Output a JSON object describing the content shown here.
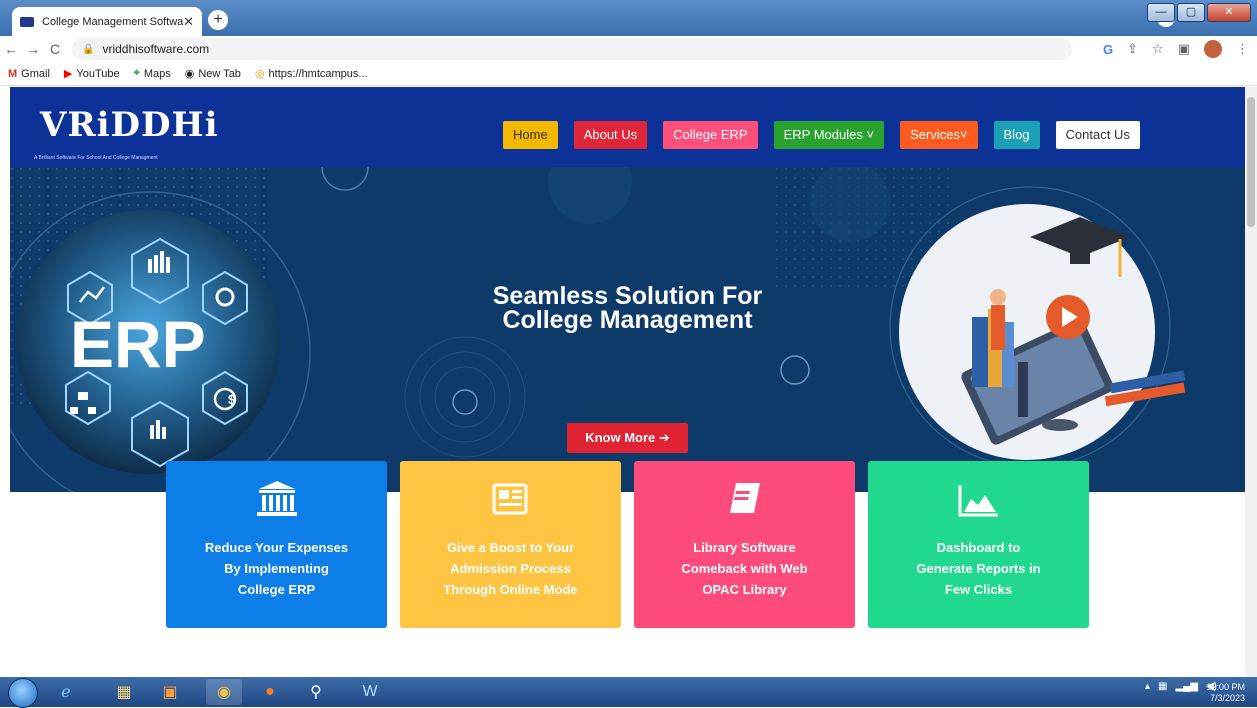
{
  "browser": {
    "tab_title": "College Management Software S",
    "url": "vriddhisoftware.com",
    "bookmarks": [
      "Gmail",
      "YouTube",
      "Maps",
      "New Tab",
      "https://hmtcampus..."
    ]
  },
  "site": {
    "logo": "VRiDDHi",
    "tagline": "A Brilliant Software For School And College Managment",
    "nav": [
      {
        "label": "Home",
        "color": "#f5b800",
        "text": "#333333"
      },
      {
        "label": "About Us",
        "color": "#e0273a",
        "text": "#ffffff"
      },
      {
        "label": "College ERP",
        "color": "#ff4f7b",
        "text": "#ffffff"
      },
      {
        "label": "ERP Modules ˅",
        "color": "#2aa22f",
        "text": "#ffffff"
      },
      {
        "label": "Services˅",
        "color": "#ff5a1f",
        "text": "#ffffff"
      },
      {
        "label": "Blog",
        "color": "#1aa1b5",
        "text": "#ffffff"
      },
      {
        "label": "Contact Us",
        "color": "#ffffff",
        "text": "#333333"
      }
    ],
    "hero": {
      "title_line1": "Seamless Solution For",
      "title_line2": "College Management",
      "button": "Know More ➔",
      "erp_label": "ERP"
    },
    "cards": [
      {
        "icon": "bank-icon",
        "line1": "Reduce Your Expenses",
        "line2": "By Implementing",
        "line3": "College ERP",
        "color": "#0d7de8"
      },
      {
        "icon": "newspaper-icon",
        "line1": "Give a Boost to Your",
        "line2": "Admission Process",
        "line3": "Through Online Mode",
        "color": "#ffc542"
      },
      {
        "icon": "book-icon",
        "line1": "Library Software",
        "line2": "Comeback with Web",
        "line3": "OPAC Library",
        "color": "#ff4b7c"
      },
      {
        "icon": "area-chart-icon",
        "line1": "Dashboard to",
        "line2": "Generate Reports in",
        "line3": "Few Clicks",
        "color": "#20d98f"
      }
    ]
  },
  "taskbar": {
    "time": "12:00 PM",
    "date": "7/3/2023"
  }
}
